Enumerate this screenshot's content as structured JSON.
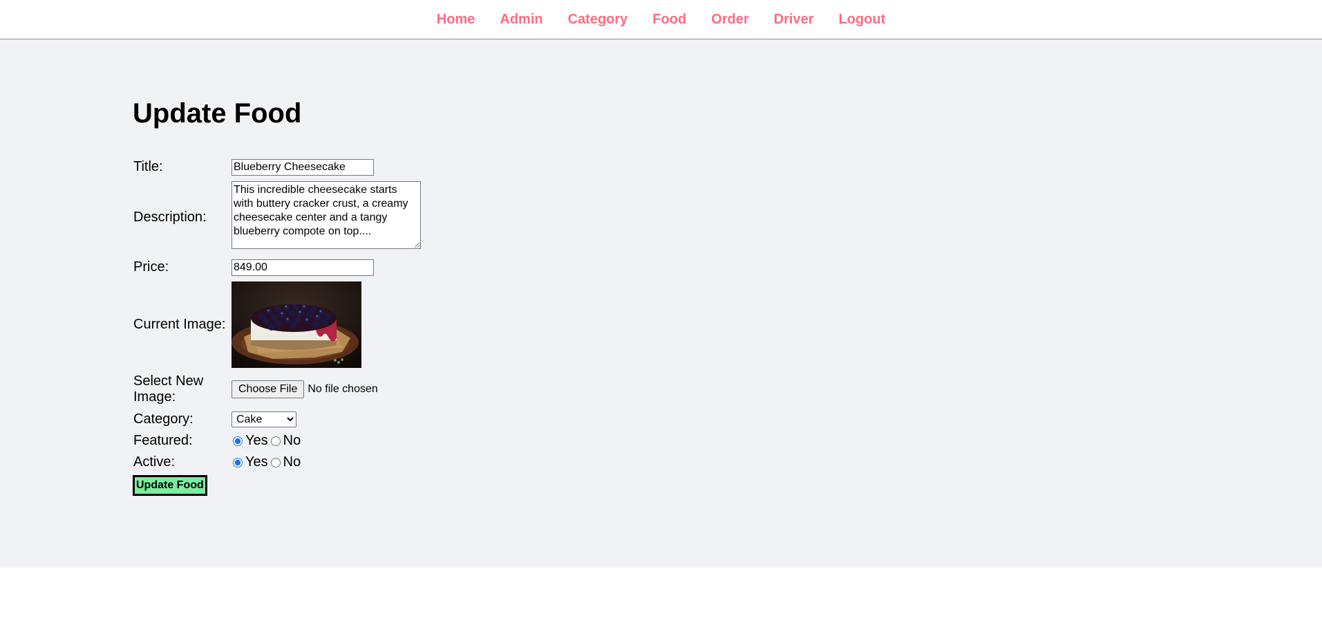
{
  "nav": {
    "items": [
      {
        "label": "Home"
      },
      {
        "label": "Admin"
      },
      {
        "label": "Category"
      },
      {
        "label": "Food"
      },
      {
        "label": "Order"
      },
      {
        "label": "Driver"
      },
      {
        "label": "Logout"
      }
    ],
    "link_color": "#ff6b81"
  },
  "page": {
    "title": "Update Food"
  },
  "form": {
    "title_label": "Title:",
    "title_value": "Blueberry Cheesecake",
    "description_label": "Description:",
    "description_value": "This incredible cheesecake starts with buttery cracker crust, a creamy cheesecake center and a tangy blueberry compote on top....",
    "price_label": "Price:",
    "price_value": "849.00",
    "current_image_label": "Current Image:",
    "current_image_desc": "blueberry-cheesecake-photo",
    "new_image_label": "Select New Image:",
    "file_button": "Choose File",
    "file_status": "No file chosen",
    "category_label": "Category:",
    "category_selected": "Cake",
    "featured_label": "Featured:",
    "featured_yes": "Yes",
    "featured_no": "No",
    "featured_value": "Yes",
    "active_label": "Active:",
    "active_yes": "Yes",
    "active_no": "No",
    "active_value": "Yes",
    "submit_label": "Update Food",
    "submit_color": "#7bed9f"
  },
  "colors": {
    "main_bg": "#f1f2f6"
  }
}
